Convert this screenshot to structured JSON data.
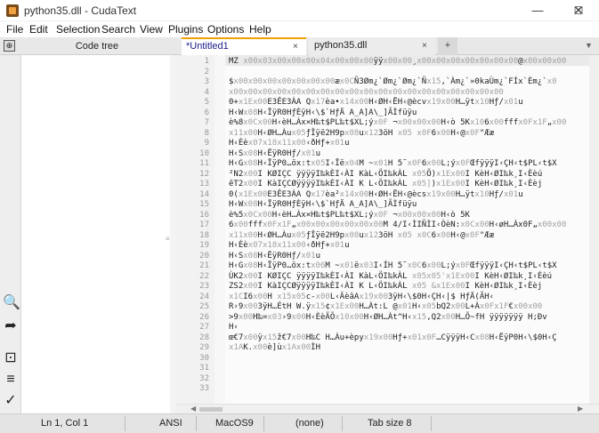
{
  "window": {
    "title": "python35.dll - CudaText",
    "minimize": "—",
    "maximize": "☐",
    "close": "✕"
  },
  "menu": [
    "File",
    "Edit",
    "Selection",
    "Search",
    "View",
    "Plugins",
    "Options",
    "Help"
  ],
  "codetree": {
    "icon": "⊕",
    "title": "Code tree"
  },
  "tabs": [
    {
      "label": "*Untitled1",
      "close": "×"
    },
    {
      "label": "python35.dll",
      "close": "×"
    },
    {
      "label": "+"
    }
  ],
  "tab_menu": "▼",
  "left_icons": [
    "search-icon",
    "arrow-right-icon",
    "terminal-icon",
    "menu-icon",
    "check-icon"
  ],
  "left_icon_glyphs": [
    "🔍",
    "➦",
    "⊡",
    "≡",
    "✓"
  ],
  "sidebar_grip": "≡",
  "editor": {
    "line_numbers": [
      "1",
      "2",
      "3",
      "4",
      "5",
      "6",
      "7",
      "8",
      "9",
      "10",
      "11",
      "12",
      "13",
      "14",
      "15",
      "16",
      "17",
      "18",
      "19",
      "20",
      "21",
      "22",
      "23",
      "24",
      "25",
      "26",
      "27",
      "28",
      "29",
      "30",
      "31",
      "32",
      "33"
    ],
    "lines": [
      [
        [
          "MZ ",
          0
        ],
        [
          "x00x03x00x00x00x04x00x00x00",
          1
        ],
        [
          "ÿÿ",
          0
        ],
        [
          "x00x00",
          1
        ],
        [
          "¸",
          0
        ],
        [
          "x00x00x00x00x00x00x00",
          1
        ],
        [
          "@",
          0
        ],
        [
          "x00x00x00",
          1
        ]
      ],
      [],
      [
        [
          "$",
          0
        ],
        [
          "x00x00x00x00x00x00x00",
          1
        ],
        [
          "æ",
          0
        ],
        [
          "x0C",
          1
        ],
        [
          "Ñ3Øm¿`Øm¿`Øm¿`Ñ",
          0
        ],
        [
          "x15",
          1
        ],
        [
          ",`Àm¿`»0kaÙm¿`FÍx`Èm¿`",
          0
        ],
        [
          "x0",
          1
        ]
      ],
      [
        [
          "x00x00x00x00x00x00x00x00x00x00x00x00x00x00x00x00x00x00x00",
          1
        ]
      ],
      [
        [
          "0+",
          0
        ],
        [
          "x1Ex00",
          1
        ],
        [
          "E3ÊE3ÀA Q",
          0
        ],
        [
          "x17",
          1
        ],
        [
          "èa•",
          0
        ],
        [
          "x14x00",
          1
        ],
        [
          "H‹ØH‹ËH‹@ècv",
          0
        ],
        [
          "x19x00",
          1
        ],
        [
          "H…ÿt",
          0
        ],
        [
          "x10",
          1
        ],
        [
          "Hƒ/",
          0
        ],
        [
          "x01",
          1
        ],
        [
          "u",
          0
        ]
      ],
      [
        [
          "H‹W",
          0
        ],
        [
          "x08",
          1
        ],
        [
          "H‹ÏÿR0HƒÈÿH‹\\$`HƒÄ A_A]A\\_]ÃÌfüÿu",
          0
        ]
      ],
      [
        [
          "è%8",
          0
        ],
        [
          "x0Cx00",
          1
        ],
        [
          "H‹èH…Àx×H‰t$PL‰t$XL;ý",
          0
        ],
        [
          "x0F",
          1
        ],
        [
          " ¬",
          0
        ],
        [
          "x00x00x00",
          1
        ],
        [
          "H‹ò 5K",
          0
        ],
        [
          "x10",
          1
        ],
        [
          "6",
          0
        ],
        [
          "x00",
          1
        ],
        [
          "fff",
          0
        ],
        [
          "x0Fx1F",
          1
        ],
        [
          "„",
          0
        ],
        [
          "x00",
          1
        ]
      ],
      [
        [
          "x11x00",
          1
        ],
        [
          "H‹ØH…Àu",
          0
        ],
        [
          "x05",
          1
        ],
        [
          "ƒÎÿë2H9p",
          0
        ],
        [
          "x08",
          1
        ],
        [
          "u",
          0
        ],
        [
          "x12",
          1
        ],
        [
          "3öH ",
          0
        ],
        [
          "x05",
          1
        ],
        [
          " ",
          0
        ],
        [
          "x0F",
          1
        ],
        [
          "6",
          0
        ],
        [
          "x00",
          1
        ],
        [
          "H‹@",
          0
        ],
        [
          "x0F",
          1
        ],
        [
          "\"Ææ",
          0
        ]
      ],
      [
        [
          "H‹Èè",
          0
        ],
        [
          "x07x18x11x00",
          1
        ],
        [
          "‹ðHƒ+",
          0
        ],
        [
          "x01",
          1
        ],
        [
          "u",
          0
        ]
      ],
      [
        [
          "H‹S",
          0
        ],
        [
          "x08",
          1
        ],
        [
          "H‹ËÿR0Hƒ/",
          0
        ],
        [
          "x01",
          1
        ],
        [
          "u",
          0
        ]
      ],
      [
        [
          "H‹G",
          0
        ],
        [
          "x08",
          1
        ],
        [
          "H‹ÏÿP0…öx:t",
          0
        ],
        [
          "x05",
          1
        ],
        [
          "I‹Ïë",
          0
        ],
        [
          "x04",
          1
        ],
        [
          "M ~",
          0
        ],
        [
          "x01",
          1
        ],
        [
          "H 5˜",
          0
        ],
        [
          "x0F",
          1
        ],
        [
          "6",
          0
        ],
        [
          "x00",
          1
        ],
        [
          "L;ý",
          0
        ],
        [
          "x0F",
          1
        ],
        [
          "ŒfÿÿÿI‹ÇH‹t$PL‹t$X",
          0
        ]
      ],
      [
        [
          "²N2",
          0
        ],
        [
          "x00",
          1
        ],
        [
          "I KØIÇC ÿÿÿÿI‰kÈI‹ÀI KàL‹ÖI‰kÀL ",
          0
        ],
        [
          "x05",
          1
        ],
        [
          "Õ)",
          0
        ],
        [
          "x1Ex00",
          1
        ],
        [
          "I KèH‹ØI‰k¸I‹Èèú",
          0
        ]
      ],
      [
        [
          "êT2",
          0
        ],
        [
          "x00",
          1
        ],
        [
          "I KàIÇCØÿÿÿÿI‰kÈI‹ÀI K L‹ÖI‰kÀL ",
          0
        ],
        [
          "x05]",
          1
        ],
        [
          ")",
          0
        ],
        [
          "x1Ex00",
          1
        ],
        [
          "I KèH‹ØI‰k¸I‹Èèj",
          0
        ]
      ],
      [
        [
          "0(",
          0
        ],
        [
          "x1Ex00",
          1
        ],
        [
          "E3ÊE3ÀA Q",
          0
        ],
        [
          "x17",
          1
        ],
        [
          "èa²",
          0
        ],
        [
          "x14x00",
          1
        ],
        [
          "H‹ØH‹ËH‹@ècs",
          0
        ],
        [
          "x19x00",
          1
        ],
        [
          "H…ÿt",
          0
        ],
        [
          "x10",
          1
        ],
        [
          "Hƒ/",
          0
        ],
        [
          "x01",
          1
        ],
        [
          "u",
          0
        ]
      ],
      [
        [
          "H‹W",
          0
        ],
        [
          "x08",
          1
        ],
        [
          "H‹ÏÿR0HƒÈÿH‹\\$`HƒÄ A_A]A\\_]ÃÌfüÿu",
          0
        ]
      ],
      [
        [
          "è%5",
          0
        ],
        [
          "x0Cx00",
          1
        ],
        [
          "H‹èH…Àx×H‰t$PL‰t$XL;ý",
          0
        ],
        [
          "x0F",
          1
        ],
        [
          " ¬",
          0
        ],
        [
          "x00x00x00",
          1
        ],
        [
          "H‹ò 5K",
          0
        ]
      ],
      [
        [
          "6",
          0
        ],
        [
          "x00",
          1
        ],
        [
          "fff",
          0
        ],
        [
          "x0Fx1F",
          1
        ],
        [
          "„",
          0
        ],
        [
          "x00x00x00x00x00x00",
          1
        ],
        [
          "M 4/I‹ÌIÑÌI‹ÒèN:",
          0
        ],
        [
          "x0Cx00",
          1
        ],
        [
          "H‹øH…Àx0F",
          0
        ],
        [
          "„",
          0
        ],
        [
          "x00x00",
          1
        ]
      ],
      [
        [
          "x11x00",
          1
        ],
        [
          "H‹ØH…Àu",
          0
        ],
        [
          "x05",
          1
        ],
        [
          "ƒÎÿë2H9p",
          0
        ],
        [
          "x08",
          1
        ],
        [
          "u",
          0
        ],
        [
          "x12",
          1
        ],
        [
          "3öH ",
          0
        ],
        [
          "x05",
          1
        ],
        [
          " ",
          0
        ],
        [
          "x0C",
          1
        ],
        [
          "6",
          0
        ],
        [
          "x00",
          1
        ],
        [
          "H‹@",
          0
        ],
        [
          "x0F",
          1
        ],
        [
          "\"Ææ",
          0
        ]
      ],
      [
        [
          "H‹Èè",
          0
        ],
        [
          "x07x18x11x00",
          1
        ],
        [
          "‹ðHƒ+",
          0
        ],
        [
          "x01",
          1
        ],
        [
          "u",
          0
        ]
      ],
      [
        [
          "H‹S",
          0
        ],
        [
          "x08",
          1
        ],
        [
          "H‹ËÿR0Hƒ/",
          0
        ],
        [
          "x01",
          1
        ],
        [
          "u",
          0
        ]
      ],
      [
        [
          "H‹G",
          0
        ],
        [
          "x08",
          1
        ],
        [
          "H‹ÏÿP0…öx:t",
          0
        ],
        [
          "x06",
          1
        ],
        [
          "M ~",
          0
        ],
        [
          "x01",
          1
        ],
        [
          "ë",
          0
        ],
        [
          "x03",
          1
        ],
        [
          "I‹ÍH 5˜",
          0
        ],
        [
          "x0C",
          1
        ],
        [
          "6",
          0
        ],
        [
          "x00",
          1
        ],
        [
          "L;ý",
          0
        ],
        [
          "x0F",
          1
        ],
        [
          "ŒfÿÿÿI‹ÇH‹t$PL‹t$X",
          0
        ]
      ],
      [
        [
          "ÙK2",
          0
        ],
        [
          "x00",
          1
        ],
        [
          "I KØIÇC ÿÿÿÿI‰kÈI‹ÀI KàL‹ÖI‰kÀL ",
          0
        ],
        [
          "x05x05'",
          1
        ],
        [
          "x1Ex00",
          1
        ],
        [
          "I KèH‹ØI‰k¸I‹Èèú",
          0
        ]
      ],
      [
        [
          "ZS2",
          0
        ],
        [
          "x00",
          1
        ],
        [
          "I KàIÇCØÿÿÿÿI‰kÈI‹ÀI K L‹ÖI‰kÀL ",
          0
        ],
        [
          "x05 &",
          1
        ],
        [
          "x1Ex00",
          1
        ],
        [
          "I KèH‹ØI‰k¸I‹Èèj",
          0
        ]
      ],
      [
        [
          "x1C",
          1
        ],
        [
          "I6",
          0
        ],
        [
          "x00",
          1
        ],
        [
          "H ",
          0
        ],
        [
          "x15x05",
          1
        ],
        [
          "c-",
          0
        ],
        [
          "x00",
          1
        ],
        [
          "L‹ÂèâA",
          0
        ],
        [
          "x19x00",
          1
        ],
        [
          "3ÿH‹\\$0H‹ÇH‹|$ HƒÄ(ÃH‹",
          0
        ]
      ],
      [
        [
          "R›9",
          0
        ],
        [
          "x00",
          1
        ],
        [
          "3ÿH…ÉtH W.ÿ",
          0
        ],
        [
          "x15",
          1
        ],
        [
          "¢",
          0
        ],
        [
          "x1Ex00",
          1
        ],
        [
          "H…Àt:L @",
          0
        ],
        [
          "x01",
          1
        ],
        [
          "H‹",
          0
        ],
        [
          "x05",
          1
        ],
        [
          "bQ2",
          0
        ],
        [
          "x00",
          1
        ],
        [
          "L+À",
          0
        ],
        [
          "x0Fx1F",
          1
        ],
        [
          "€",
          0
        ],
        [
          "x00x00",
          1
        ]
      ],
      [
        [
          ">9",
          0
        ],
        [
          "x00",
          1
        ],
        [
          "H‰=",
          0
        ],
        [
          "x03",
          1
        ],
        [
          "›9",
          0
        ],
        [
          "x00",
          1
        ],
        [
          "H‹ÈèÃÕ",
          0
        ],
        [
          "x10x00",
          1
        ],
        [
          "H‹ØH…Àt^H‹",
          0
        ],
        [
          "x15",
          1
        ],
        [
          ",Q2",
          0
        ],
        [
          "x00",
          1
        ],
        [
          "H…Õ~fH ÿÿÿÿÿÿÿ H;Ðv",
          0
        ]
      ],
      [
        [
          "H‹",
          0
        ]
      ],
      [
        [
          "œ€7",
          0
        ],
        [
          "x00",
          1
        ],
        [
          "ÿ",
          0
        ],
        [
          "x15",
          1
        ],
        [
          "ž€7",
          0
        ],
        [
          "x00",
          1
        ],
        [
          "H‰C H…Àu+èpy",
          0
        ],
        [
          "x19x00",
          1
        ],
        [
          "Hƒ+",
          0
        ],
        [
          "x01x0F",
          1
        ],
        [
          "…CÿÿÿH‹C",
          0
        ],
        [
          "x08",
          1
        ],
        [
          "H‹ËÿP0H‹\\$0H‹Ç",
          0
        ]
      ],
      [
        [
          "x1A",
          1
        ],
        [
          "K.",
          0
        ],
        [
          "x00",
          1
        ],
        [
          "è]ù",
          0
        ],
        [
          "x1Ax00",
          1
        ],
        [
          "ÌH",
          0
        ]
      ],
      [],
      [],
      [],
      []
    ]
  },
  "status": {
    "position": "Ln 1, Col 1",
    "encoding": "ANSI",
    "line_ends": "MacOS9",
    "lexer": "(none)",
    "tab_size": "Tab size 8"
  },
  "scroll": {
    "left": "◀",
    "right": "▶"
  }
}
